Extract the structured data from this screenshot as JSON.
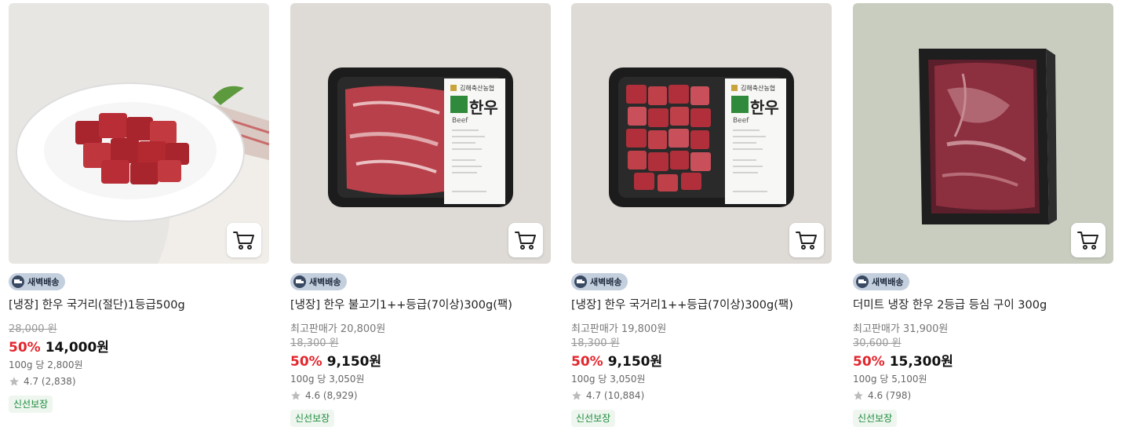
{
  "products": [
    {
      "badge": "새벽배송",
      "title": "[냉장] 한우 국거리(절단)1등급500g",
      "max_price": "",
      "original_price": "28,000 원",
      "discount": "50%",
      "price": "14,000원",
      "unit_price": "100g 당 2,800원",
      "rating": "4.7 (2,838)",
      "tag": "신선보장",
      "icon": "cart-icon"
    },
    {
      "badge": "새벽배송",
      "title": "[냉장] 한우 불고기1++등급(7이상)300g(팩)",
      "max_price": "최고판매가 20,800원",
      "original_price": "18,300 원",
      "discount": "50%",
      "price": "9,150원",
      "unit_price": "100g 당 3,050원",
      "rating": "4.6 (8,929)",
      "tag": "신선보장",
      "icon": "cart-icon"
    },
    {
      "badge": "새벽배송",
      "title": "[냉장] 한우 국거리1++등급(7이상)300g(팩)",
      "max_price": "최고판매가 19,800원",
      "original_price": "18,300 원",
      "discount": "50%",
      "price": "9,150원",
      "unit_price": "100g 당 3,050원",
      "rating": "4.7 (10,884)",
      "tag": "신선보장",
      "icon": "cart-icon"
    },
    {
      "badge": "새벽배송",
      "title": "더미트 냉장 한우 2등급 등심 구이 300g",
      "max_price": "최고판매가 31,900원",
      "original_price": "30,600 원",
      "discount": "50%",
      "price": "15,300원",
      "unit_price": "100g 당 5,100원",
      "rating": "4.6 (798)",
      "tag": "신선보장",
      "icon": "cart-icon"
    }
  ],
  "package_label": {
    "brand": "김해축산농협",
    "name": "한우",
    "sub": "Beef"
  },
  "colors": {
    "discount": "#e3262d",
    "fresh_tag": "#1b8a3a",
    "badge_bg": "#c4cfde"
  }
}
